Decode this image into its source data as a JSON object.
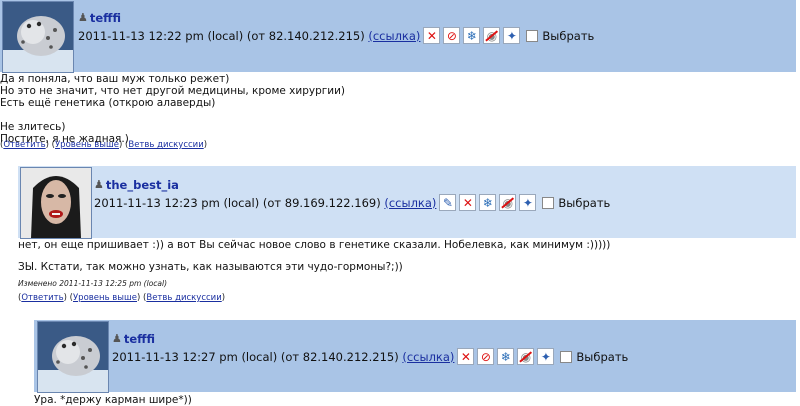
{
  "comments": [
    {
      "username": "tefffi",
      "datetime": "2011-11-13 12:22 pm (local)",
      "ip": "(от 82.140.212.215)",
      "link_label": "(ссылка)",
      "select_label": "Выбрать",
      "lines": [
        "Да я поняла, что ваш муж только режет)",
        "Но это не значит, что нет другой медицины, кроме хирургии)",
        "Есть ещё генетика (открою алаверды)",
        "",
        "Не злитесь)",
        "Постите, я не жадная.)"
      ],
      "actions": {
        "reply": "Ответить",
        "up": "Уровень выше",
        "thread": "Ветвь дискуссии"
      }
    },
    {
      "username": "the_best_ia",
      "datetime": "2011-11-13 12:23 pm (local)",
      "ip": "(от 89.169.122.169)",
      "link_label": "(ссылка)",
      "select_label": "Выбрать",
      "lines": [
        "нет, он еще пришивает :)) а вот Вы сейчас новое слово в генетике сказали. Нобелевка, как минимум :)))))",
        "",
        "ЗЫ. Кстати, так можно узнать, как называются эти чудо-гормоны?;))"
      ],
      "edited": "Изменено 2011-11-13 12:25 pm (local)",
      "actions": {
        "reply": "Ответить",
        "up": "Уровень выше",
        "thread": "Ветвь дискуссии"
      }
    },
    {
      "username": "tefffi",
      "datetime": "2011-11-13 12:27 pm (local)",
      "ip": "(от 82.140.212.215)",
      "link_label": "(ссылка)",
      "select_label": "Выбрать",
      "lines": [
        "Ура. *держу карман шире*))"
      ]
    }
  ],
  "icons": {
    "user": "user-icon",
    "delete": "delete-icon",
    "ban": "ban-icon",
    "freeze": "freeze-icon",
    "hide": "hide-icon",
    "track": "track-pin-icon",
    "edit": "edit-pencil-icon"
  },
  "colors": {
    "header_dark": "#a9c4e6",
    "header_light": "#cfe0f4",
    "link": "#1a2fa0"
  }
}
